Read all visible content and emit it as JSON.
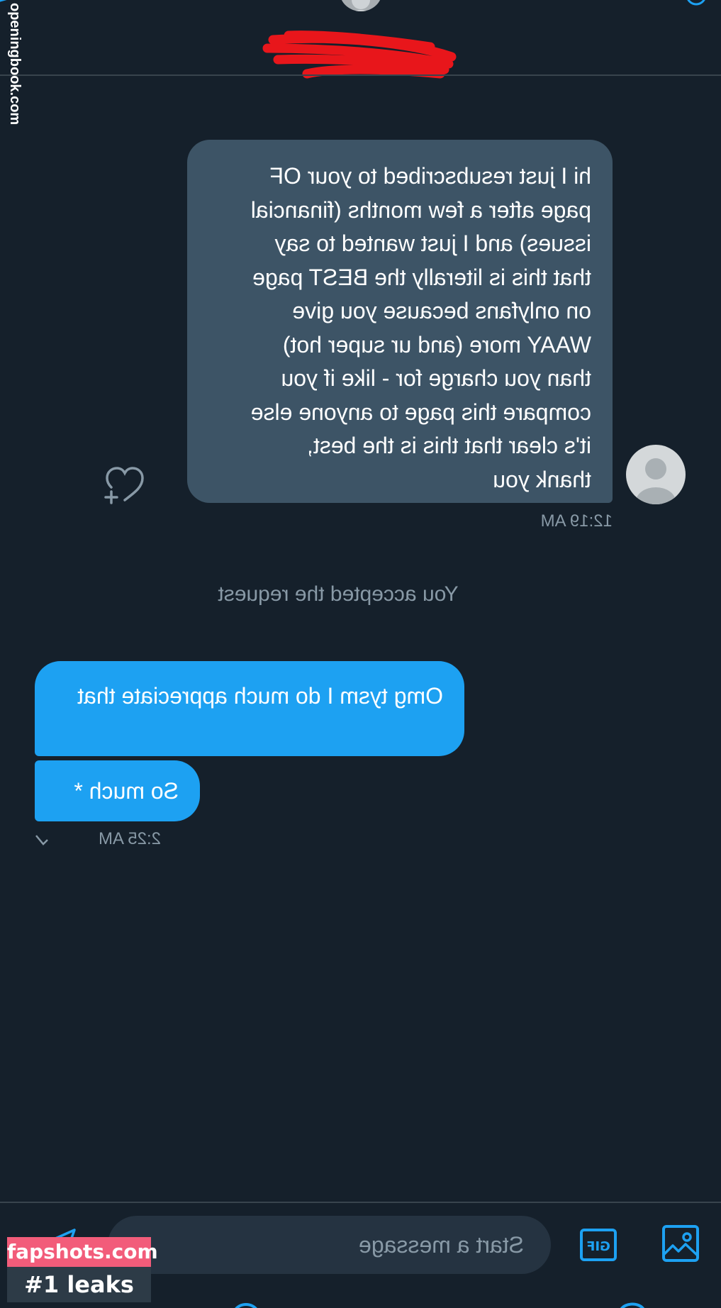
{
  "header": {
    "back_icon": "arrow-left-icon",
    "info_icon": "info-icon",
    "contact_name": "",
    "accent_color": "#1da1f2",
    "redaction_color": "#e8161b"
  },
  "conversation": {
    "incoming": {
      "text": "hi I just resubscribed to your OF\npage after a few months (financial\nissues) and I just wanted to say\nthat this is literally the BEST page\non onlyfans because you give\nWAAY more (and ur super hot)\nthan you charge for - like if you\ncompare this page to anyone else\nit's clear that this is the best,\nthank you",
      "time": "12:19 AM",
      "bubble_color": "#3d5466",
      "like_icon": "heart-plus-icon"
    },
    "system_note": "You accepted the request",
    "outgoing": {
      "messages": [
        "Omg tysm I do much appreciate that",
        "So much *"
      ],
      "time": "2:25 AM",
      "status_icon": "checkmark-icon",
      "bubble_color": "#1da1f2"
    }
  },
  "composer": {
    "placeholder": "Start a message",
    "image_icon": "image-icon",
    "gif_icon": "gif-icon",
    "send_icon": "send-icon"
  },
  "watermarks": {
    "side_text": "openingbook.com",
    "badge_top": "fapshots.com",
    "badge_bottom": "#1 leaks",
    "badge_color": "#f25c7a"
  },
  "theme": {
    "background": "#15202b",
    "divider": "#38444d",
    "secondary_text": "#8899a6"
  }
}
